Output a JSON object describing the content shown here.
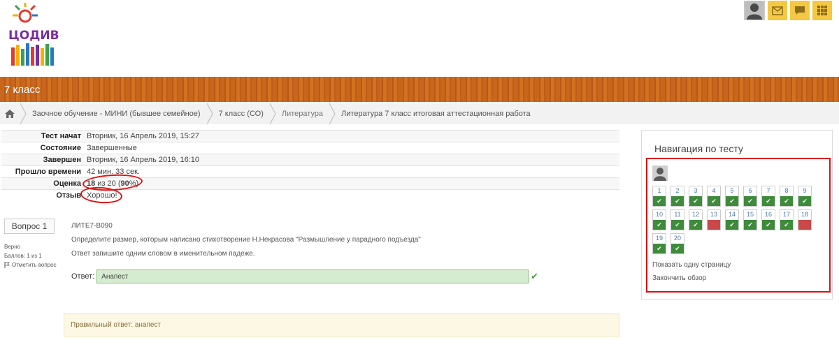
{
  "header": {
    "logo_text": "ЦОДИВ",
    "course_title": "7 класс"
  },
  "breadcrumb": [
    {
      "label": "Заочное обучение - МИНИ (бывшее семейное)"
    },
    {
      "label": "7 класс (СО)"
    },
    {
      "label": "Литература"
    },
    {
      "label": "Литература 7 класс итоговая аттестационная работа"
    }
  ],
  "summary": {
    "started_label": "Тест начат",
    "started_value": "Вторник, 16 Апрель 2019, 15:27",
    "state_label": "Состояние",
    "state_value": "Завершенные",
    "completed_label": "Завершен",
    "completed_value": "Вторник, 16 Апрель 2019, 16:10",
    "time_label": "Прошло времени",
    "time_value": "42 мин. 33 сек.",
    "grade_label": "Оценка",
    "grade_score": "18",
    "grade_mid": " из 20 (",
    "grade_percent": "90",
    "grade_end": "%)",
    "feedback_label": "Отзыв",
    "feedback_value": "Хорошо!"
  },
  "question": {
    "number_label": "Вопрос 1",
    "status": "Верно",
    "points": "Баллов: 1 из 1",
    "flag_label": "Отметить вопрос",
    "code": "ЛИТЕ7-В090",
    "text": "Определите размер, которым написано стихотворение Н.Некрасова \"Размышление у парадного подъезда\"",
    "instruction": "Ответ запишите одним словом в именительном падеже.",
    "answer_label": "Ответ:",
    "answer_value": "Анапест",
    "correct_answer": "Правильный ответ: анапест"
  },
  "navigation": {
    "title": "Навигация по тесту",
    "questions": [
      {
        "n": "1",
        "status": "correct"
      },
      {
        "n": "2",
        "status": "correct"
      },
      {
        "n": "3",
        "status": "correct"
      },
      {
        "n": "4",
        "status": "correct"
      },
      {
        "n": "5",
        "status": "correct"
      },
      {
        "n": "6",
        "status": "correct"
      },
      {
        "n": "7",
        "status": "correct"
      },
      {
        "n": "8",
        "status": "correct"
      },
      {
        "n": "9",
        "status": "correct"
      },
      {
        "n": "10",
        "status": "correct"
      },
      {
        "n": "11",
        "status": "correct"
      },
      {
        "n": "12",
        "status": "correct"
      },
      {
        "n": "13",
        "status": "incorrect"
      },
      {
        "n": "14",
        "status": "correct"
      },
      {
        "n": "15",
        "status": "correct"
      },
      {
        "n": "16",
        "status": "correct"
      },
      {
        "n": "17",
        "status": "correct"
      },
      {
        "n": "18",
        "status": "incorrect"
      },
      {
        "n": "19",
        "status": "correct"
      },
      {
        "n": "20",
        "status": "correct"
      }
    ],
    "show_one_page": "Показать одну страницу",
    "finish_review": "Закончить обзор"
  },
  "colors": {
    "banner": "#c8661d",
    "correct": "#3e8b3c",
    "incorrect": "#c9484a",
    "annotation": "#e01010"
  }
}
